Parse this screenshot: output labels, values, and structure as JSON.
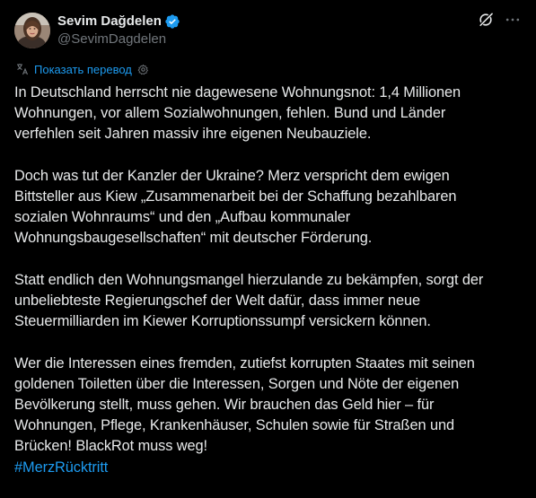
{
  "author": {
    "display_name": "Sevim Dağdelen",
    "handle": "@SevimDagdelen",
    "verified": true
  },
  "actions": {
    "grok_icon": "grok-icon",
    "more_icon": "more-icon"
  },
  "translate": {
    "label": "Показать перевод"
  },
  "tweet": {
    "paragraphs": [
      [
        "In Deutschland herrscht nie dagewesene Wohnungsnot: 1,4 Millionen",
        "Wohnungen, vor allem Sozialwohnungen, fehlen. Bund und Länder",
        "verfehlen seit Jahren massiv ihre eigenen Neubauziele."
      ],
      [
        "Doch was tut der Kanzler der Ukraine? Merz verspricht dem ewigen",
        "Bittsteller aus Kiew „Zusammenarbeit bei der Schaffung bezahlbaren",
        "sozialen Wohnraums“ und den „Aufbau kommunaler",
        "Wohnungsbaugesellschaften“ mit deutscher Förderung."
      ],
      [
        "Statt endlich den Wohnungsmangel hierzulande zu bekämpfen, sorgt der",
        "unbeliebteste Regierungschef der Welt dafür, dass immer neue",
        "Steuermilliarden im Kiewer Korruptionssumpf versickern können."
      ],
      [
        "Wer die Interessen eines fremden, zutiefst korrupten Staates mit seinen",
        "goldenen Toiletten über die Interessen, Sorgen und Nöte der eigenen",
        "Bevölkerung stellt, muss gehen. Wir brauchen das Geld hier – für",
        "Wohnungen, Pflege, Krankenhäuser, Schulen sowie für Straßen und",
        "Brücken! BlackRot muss weg!"
      ]
    ],
    "hashtag": "#MerzRücktritt"
  },
  "colors": {
    "background": "#000000",
    "text": "#e7e9ea",
    "secondary": "#71767b",
    "accent": "#1d9bf0"
  }
}
